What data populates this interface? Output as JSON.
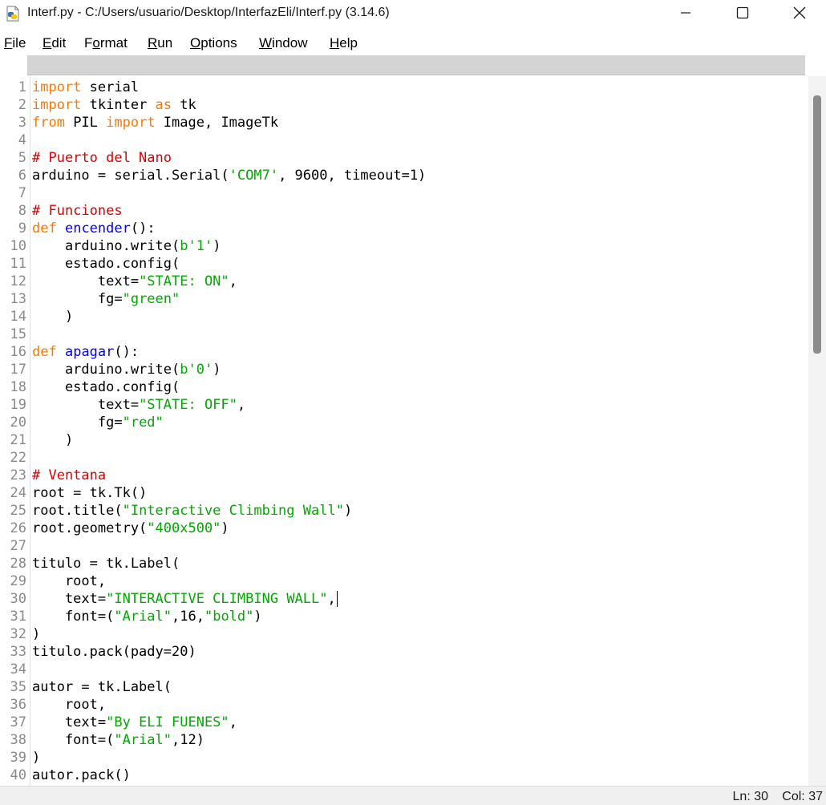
{
  "window": {
    "title": "Interf.py - C:/Users/usuario/Desktop/InterfazEli/Interf.py (3.14.6)",
    "controls": {
      "minimize_icon": "minimize-icon",
      "maximize_icon": "maximize-icon",
      "close_icon": "close-icon"
    }
  },
  "menu": {
    "items": [
      {
        "label": "File",
        "underline_index": 0
      },
      {
        "label": "Edit",
        "underline_index": 0
      },
      {
        "label": "Format",
        "underline_index": 1
      },
      {
        "label": "Run",
        "underline_index": 0
      },
      {
        "label": "Options",
        "underline_index": 0
      },
      {
        "label": "Window",
        "underline_index": 0
      },
      {
        "label": "Help",
        "underline_index": 0
      }
    ]
  },
  "editor": {
    "start_line": 1,
    "lines": [
      [
        [
          "import",
          "kw"
        ],
        [
          " serial",
          "n"
        ]
      ],
      [
        [
          "import",
          "kw"
        ],
        [
          " tkinter ",
          "n"
        ],
        [
          "as",
          "kw"
        ],
        [
          " tk",
          "n"
        ]
      ],
      [
        [
          "from",
          "kw"
        ],
        [
          " PIL ",
          "n"
        ],
        [
          "import",
          "kw"
        ],
        [
          " Image, ImageTk",
          "n"
        ]
      ],
      [],
      [
        [
          "# Puerto del Nano",
          "cm"
        ]
      ],
      [
        [
          "arduino = serial.Serial(",
          "n"
        ],
        [
          "'COM7'",
          "st"
        ],
        [
          ", 9600, timeout=1)",
          "n"
        ]
      ],
      [],
      [
        [
          "# Funciones",
          "cm"
        ]
      ],
      [
        [
          "def",
          "kw"
        ],
        [
          " ",
          "n"
        ],
        [
          "encender",
          "df"
        ],
        [
          "():",
          "n"
        ]
      ],
      [
        [
          "    arduino.write(",
          "n"
        ],
        [
          "b'1'",
          "st"
        ],
        [
          ")",
          "n"
        ]
      ],
      [
        [
          "    estado.config(",
          "n"
        ]
      ],
      [
        [
          "        text=",
          "n"
        ],
        [
          "\"STATE: ON\"",
          "st"
        ],
        [
          ",",
          "n"
        ]
      ],
      [
        [
          "        fg=",
          "n"
        ],
        [
          "\"green\"",
          "st"
        ]
      ],
      [
        [
          "    )",
          "n"
        ]
      ],
      [],
      [
        [
          "def",
          "kw"
        ],
        [
          " ",
          "n"
        ],
        [
          "apagar",
          "df"
        ],
        [
          "():",
          "n"
        ]
      ],
      [
        [
          "    arduino.write(",
          "n"
        ],
        [
          "b'0'",
          "st"
        ],
        [
          ")",
          "n"
        ]
      ],
      [
        [
          "    estado.config(",
          "n"
        ]
      ],
      [
        [
          "        text=",
          "n"
        ],
        [
          "\"STATE: OFF\"",
          "st"
        ],
        [
          ",",
          "n"
        ]
      ],
      [
        [
          "        fg=",
          "n"
        ],
        [
          "\"red\"",
          "st"
        ]
      ],
      [
        [
          "    )",
          "n"
        ]
      ],
      [],
      [
        [
          "# Ventana",
          "cm"
        ]
      ],
      [
        [
          "root = tk.Tk()",
          "n"
        ]
      ],
      [
        [
          "root.title(",
          "n"
        ],
        [
          "\"Interactive Climbing Wall\"",
          "st"
        ],
        [
          ")",
          "n"
        ]
      ],
      [
        [
          "root.geometry(",
          "n"
        ],
        [
          "\"400x500\"",
          "st"
        ],
        [
          ")",
          "n"
        ]
      ],
      [],
      [
        [
          "titulo = tk.Label(",
          "n"
        ]
      ],
      [
        [
          "    root,",
          "n"
        ]
      ],
      [
        [
          "    text=",
          "n"
        ],
        [
          "\"INTERACTIVE CLIMBING WALL\"",
          "st"
        ],
        [
          ",",
          "n"
        ]
      ],
      [
        [
          "    font=(",
          "n"
        ],
        [
          "\"Arial\"",
          "st"
        ],
        [
          ",16,",
          "n"
        ],
        [
          "\"bold\"",
          "st"
        ],
        [
          ")",
          "n"
        ]
      ],
      [
        [
          ")",
          "n"
        ]
      ],
      [
        [
          "titulo.pack(pady=20)",
          "n"
        ]
      ],
      [],
      [
        [
          "autor = tk.Label(",
          "n"
        ]
      ],
      [
        [
          "    root,",
          "n"
        ]
      ],
      [
        [
          "    text=",
          "n"
        ],
        [
          "\"By ELI FUENES\"",
          "st"
        ],
        [
          ",",
          "n"
        ]
      ],
      [
        [
          "    font=(",
          "n"
        ],
        [
          "\"Arial\"",
          "st"
        ],
        [
          ",12)",
          "n"
        ]
      ],
      [
        [
          ")",
          "n"
        ]
      ],
      [
        [
          "autor.pack()",
          "n"
        ]
      ]
    ],
    "colors": {
      "keyword": "#ff7700",
      "comment": "#dd0000",
      "string": "#00aa00",
      "definition": "#0000ff",
      "normal": "#000000",
      "line_number": "#8a8a8a"
    }
  },
  "status": {
    "ln": "Ln: 30",
    "col": "Col: 37"
  }
}
